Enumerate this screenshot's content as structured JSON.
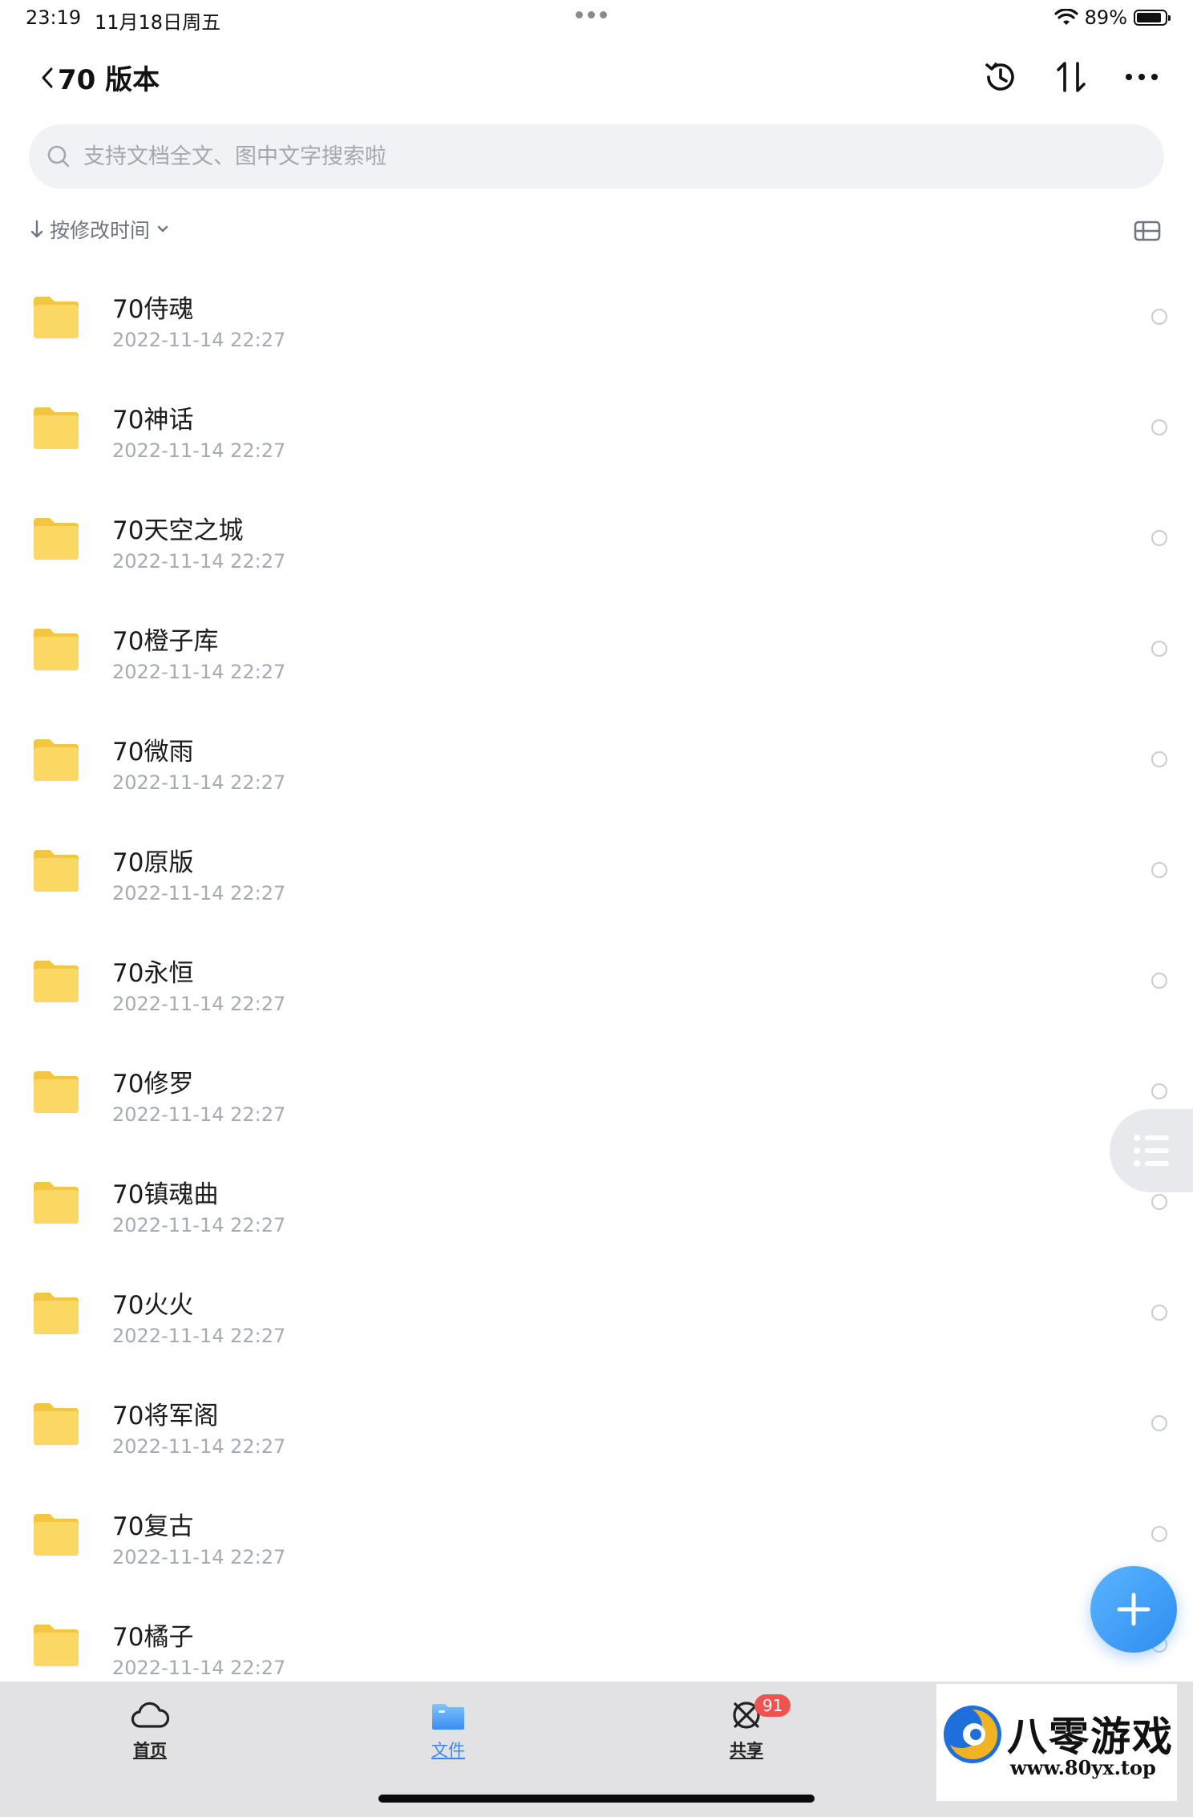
{
  "status_bar": {
    "time": "23:19",
    "date": "11月18日周五",
    "battery_percent": "89%",
    "battery_level": 0.89
  },
  "nav": {
    "title": "70 版本",
    "actions": [
      "history-icon",
      "sort-arrows-icon",
      "more-icon"
    ]
  },
  "search": {
    "placeholder": "支持文档全文、图中文字搜索啦",
    "value": ""
  },
  "sort": {
    "label": "按修改时间"
  },
  "files": [
    {
      "name": "70侍魂",
      "date": "2022-11-14 22:27"
    },
    {
      "name": "70神话",
      "date": "2022-11-14 22:27"
    },
    {
      "name": "70天空之城",
      "date": "2022-11-14 22:27"
    },
    {
      "name": "70橙子库",
      "date": "2022-11-14 22:27"
    },
    {
      "name": "70微雨",
      "date": "2022-11-14 22:27"
    },
    {
      "name": "70原版",
      "date": "2022-11-14 22:27"
    },
    {
      "name": "70永恒",
      "date": "2022-11-14 22:27"
    },
    {
      "name": "70修罗",
      "date": "2022-11-14 22:27"
    },
    {
      "name": "70镇魂曲",
      "date": "2022-11-14 22:27"
    },
    {
      "name": "70火火",
      "date": "2022-11-14 22:27"
    },
    {
      "name": "70将军阁",
      "date": "2022-11-14 22:27"
    },
    {
      "name": "70复古",
      "date": "2022-11-14 22:27"
    },
    {
      "name": "70橘子",
      "date": "2022-11-14 22:27"
    }
  ],
  "tabs": [
    {
      "label": "首页",
      "icon": "cloud-icon",
      "active": false
    },
    {
      "label": "文件",
      "icon": "folder-icon",
      "active": true
    },
    {
      "label": "共享",
      "icon": "share-icon",
      "active": false,
      "badge": "91"
    }
  ],
  "watermark": {
    "title": "八零游戏",
    "url": "www.80yx.top"
  },
  "colors": {
    "accent": "#3a86f0",
    "folder": "#f8d25c",
    "badge": "#ef5350"
  }
}
